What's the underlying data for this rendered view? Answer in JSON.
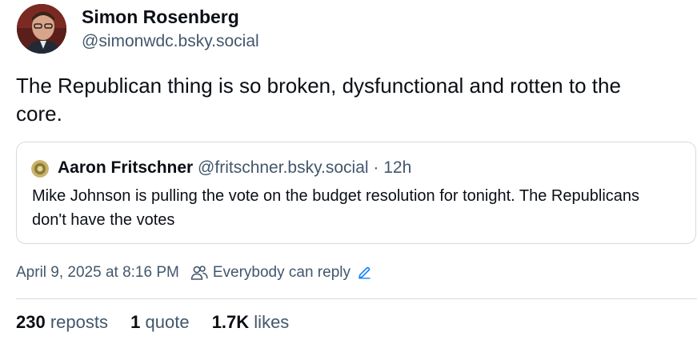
{
  "author": {
    "name": "Simon Rosenberg",
    "handle": "@simonwdc.bsky.social"
  },
  "post": {
    "text": "The Republican thing is so broken, dysfunctional and rotten to the core."
  },
  "quote": {
    "author_name": "Aaron Fritschner",
    "author_handle": "@fritschner.bsky.social",
    "separator": "·",
    "time": "12h",
    "text": "Mike Johnson is pulling the vote on the budget resolution for tonight. The Republicans don't have the votes"
  },
  "meta": {
    "timestamp": "April 9, 2025 at 8:16 PM",
    "reply_setting": "Everybody can reply",
    "icons": [
      "people-icon",
      "pencil-icon"
    ],
    "accent_color": "#1083fe"
  },
  "stats": {
    "reposts_count": "230",
    "reposts_label": "reposts",
    "quotes_count": "1",
    "quotes_label": "quote",
    "likes_count": "1.7K",
    "likes_label": "likes"
  }
}
